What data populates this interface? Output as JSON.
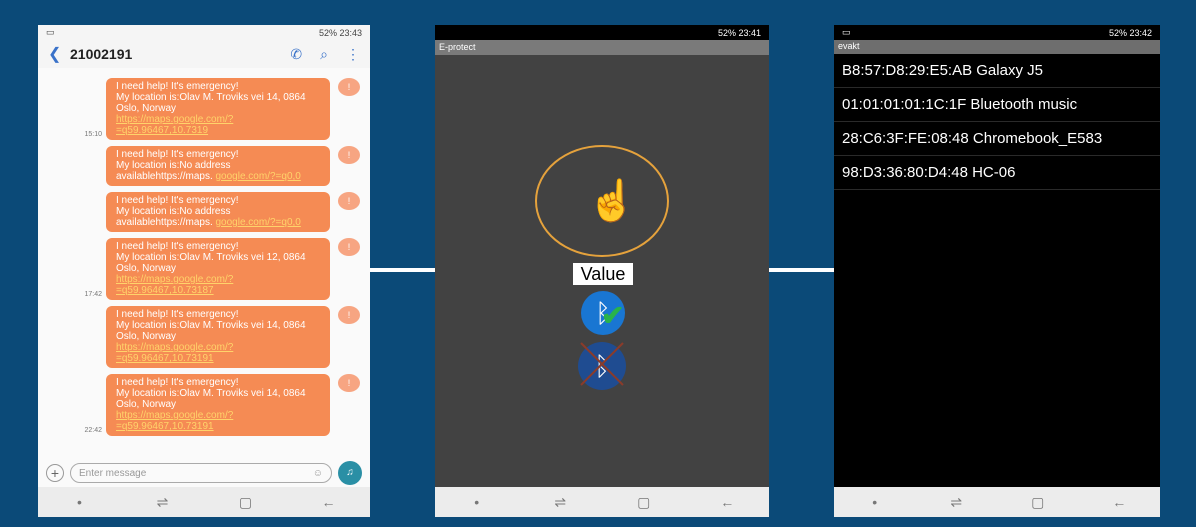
{
  "phone1": {
    "status": "52% 23:43",
    "contact_number": "21002191",
    "messages": [
      {
        "time": "15:10",
        "text": "I need help! It's emergency!\nMy location is:Olav M. Troviks vei 14, 0864 Oslo, Norway",
        "link": "https://maps.google.com/?=q59.96467,10.7319"
      },
      {
        "time": "",
        "text": "I need help! It's emergency!\nMy location is:No address availablehttps://maps.",
        "link": "google.com/?=q0,0"
      },
      {
        "time": "",
        "text": "I need help! It's emergency!\nMy location is:No address availablehttps://maps.",
        "link": "google.com/?=q0,0"
      },
      {
        "time": "17:42",
        "text": "I need help! It's emergency!\nMy location is:Olav M. Troviks vei 12, 0864 Oslo, Norway",
        "link": "https://maps.google.com/?=q59.96467,10.73187"
      },
      {
        "time": "",
        "text": "I need help! It's emergency!\nMy location is:Olav M. Troviks vei 14, 0864 Oslo, Norway",
        "link": "https://maps.google.com/?=q59.96467,10.73191"
      },
      {
        "time": "22:42",
        "text": "I need help! It's emergency!\nMy location is:Olav M. Troviks vei 14, 0864 Oslo, Norway",
        "link": "https://maps.google.com/?=q59.96467,10.73191"
      }
    ],
    "input_placeholder": "Enter message"
  },
  "phone2": {
    "status": "52% 23:41",
    "app_title": "E-protect",
    "value_label": "Value"
  },
  "phone3": {
    "status": "52% 23:42",
    "app_title": "evakt",
    "devices": [
      "B8:57:D8:29:E5:AB Galaxy J5",
      "01:01:01:01:1C:1F Bluetooth music",
      "28:C6:3F:FE:08:48 Chromebook_E583",
      "98:D3:36:80:D4:48 HC-06"
    ]
  },
  "colors": {
    "background": "#0b4a78",
    "bubble": "#f58b54",
    "accent": "#e5a23c"
  },
  "icons": [
    "back-arrow-icon",
    "phone-icon",
    "search-icon",
    "more-icon",
    "hand-tap-icon",
    "bluetooth-icon",
    "check-icon"
  ]
}
